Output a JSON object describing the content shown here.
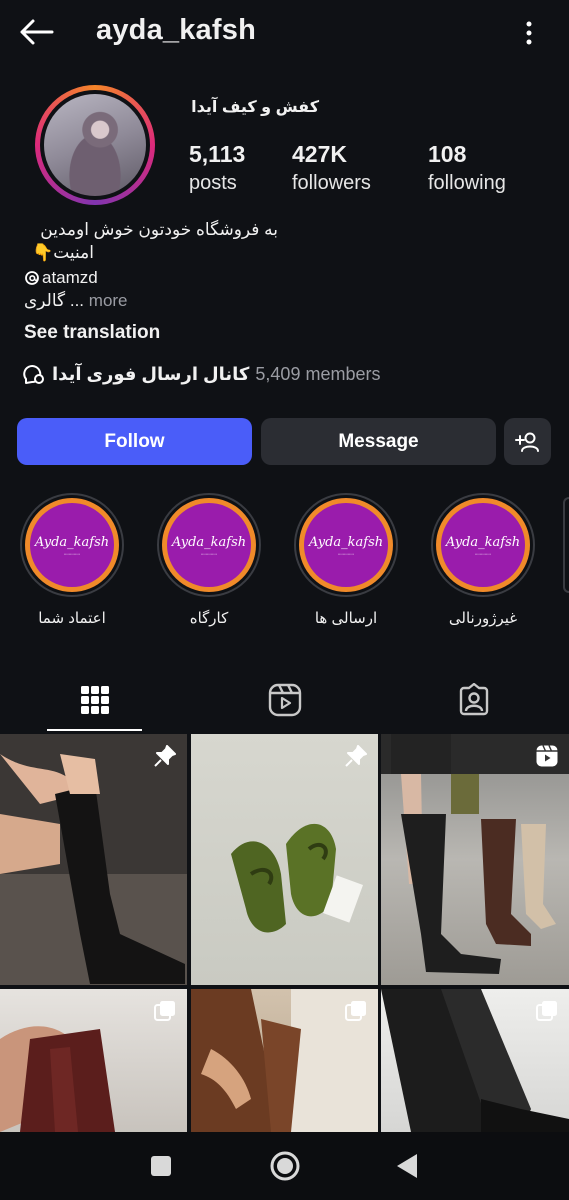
{
  "header": {
    "username": "ayda_kafsh",
    "back_icon": "arrow-left-icon",
    "menu_icon": "more-vertical-icon"
  },
  "profile": {
    "display_name": "کفش و کیف آیدا",
    "stats": {
      "posts": {
        "value": "5,113",
        "label": "posts"
      },
      "followers": {
        "value": "427K",
        "label": "followers"
      },
      "following": {
        "value": "108",
        "label": "following"
      }
    },
    "bio": {
      "line1": "به فروشگاه خودتون خوش اومدین",
      "line2": "امنیت👇",
      "mention": "atamzd",
      "line4_text": "گالری ...",
      "more_label": "more"
    },
    "see_translation": "See translation",
    "channel": {
      "name": "کانال ارسال فوری آیدا",
      "members": "5,409 members"
    }
  },
  "actions": {
    "follow_label": "Follow",
    "message_label": "Message",
    "follow_color": "#4a5df9"
  },
  "highlights": [
    {
      "label": "اعتماد شما",
      "logo": "Ayda_kafsh"
    },
    {
      "label": "کارگاه",
      "logo": "Ayda_kafsh"
    },
    {
      "label": "ارسالی ها",
      "logo": "Ayda_kafsh"
    },
    {
      "label": "غیرژورنالی",
      "logo": "Ayda_kafsh"
    }
  ],
  "tabs": [
    {
      "name": "posts",
      "icon": "grid-icon",
      "active": true
    },
    {
      "name": "reels",
      "icon": "reels-icon",
      "active": false
    },
    {
      "name": "tagged",
      "icon": "tagged-user-icon",
      "active": false
    }
  ],
  "posts": [
    {
      "badge": "pin-icon"
    },
    {
      "badge": "pin-icon"
    },
    {
      "badge": "reel-icon"
    },
    {
      "badge": "carousel-icon"
    },
    {
      "badge": "carousel-icon"
    },
    {
      "badge": "carousel-icon"
    }
  ],
  "system_nav": [
    "recents-icon",
    "home-icon",
    "back-icon"
  ]
}
